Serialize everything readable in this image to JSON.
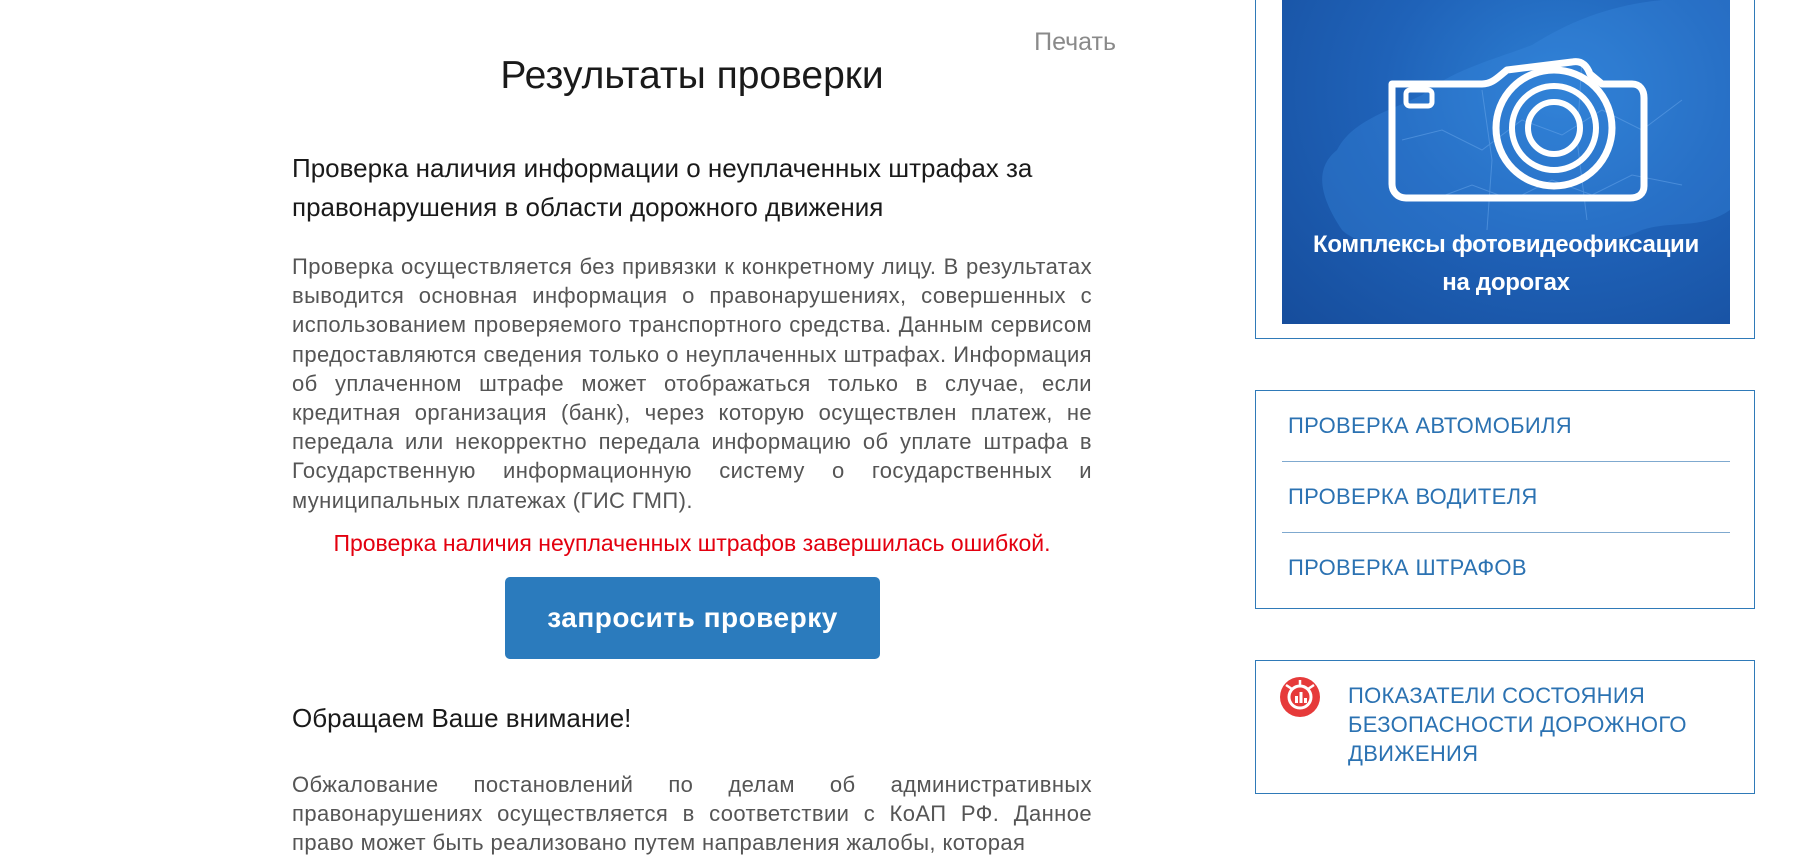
{
  "main": {
    "print_label": "Печать",
    "title": "Результаты проверки",
    "section_heading": "Проверка наличия информации о неуплаченных штрафах за правонарушения в области дорожного движения",
    "description": "Проверка осуществляется без привязки к конкретному лицу. В результатах выводится основная информация о правонарушениях, совершенных с использованием проверяемого транспортного средства. Данным сервисом предоставляются сведения только о неуплаченных штрафах. Информация об уплаченном штрафе может отображаться только в случае, если кредитная организация (банк), через которую осуществлен платеж, не передала или некорректно передала информацию об уплате штрафа в Государственную информационную систему о государственных и муниципальных платежах (ГИС ГМП).",
    "error_message": "Проверка наличия неуплаченных штрафов завершилась ошибкой.",
    "request_button": "запросить проверку",
    "attention_heading": "Обращаем Ваше внимание!",
    "appeal_text": "Обжалование постановлений по делам об административных правонарушениях осуществляется в соответствии с КоАП РФ. Данное право может быть реализовано путем направления жалобы, которая"
  },
  "sidebar": {
    "banner": {
      "caption_line1": "Комплексы фотовидеофиксации",
      "caption_line2": "на дорогах",
      "icon": "camera-icon"
    },
    "links": [
      {
        "label": "Проверка автомобиля"
      },
      {
        "label": "Проверка водителя"
      },
      {
        "label": "Проверка штрафов"
      }
    ],
    "stats": {
      "label": "ПОКАЗАТЕЛИ СОСТОЯНИЯ БЕЗОПАСНОСТИ ДОРОЖНОГО ДВИЖЕНИЯ",
      "icon": "chart-icon"
    }
  },
  "colors": {
    "accent": "#2b7bbd",
    "link": "#2b72b2",
    "error": "#e3000f",
    "banner": "#1f62b8",
    "stats_icon": "#e63a3a"
  }
}
